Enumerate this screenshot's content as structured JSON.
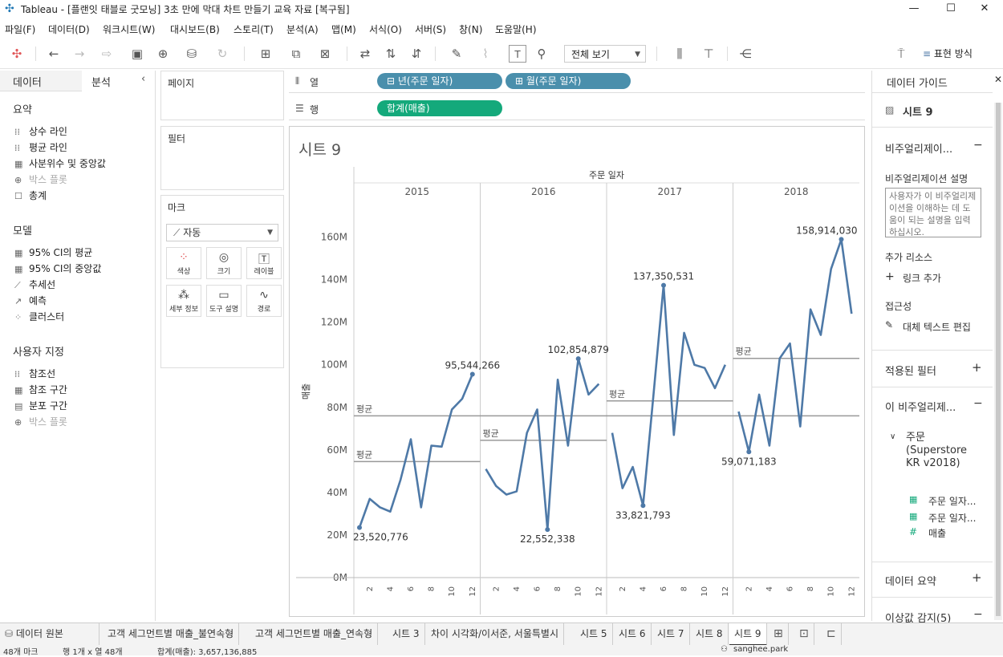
{
  "window": {
    "title": "Tableau - [플랜잇 태블로 굿모닝] 3초 만에 막대 차트 만들기 교육 자료 [복구됨]",
    "buttons": [
      "—",
      "☐",
      "✕"
    ]
  },
  "menu": [
    "파일(F)",
    "데이터(D)",
    "워크시트(W)",
    "대시보드(B)",
    "스토리(T)",
    "분석(A)",
    "맵(M)",
    "서식(O)",
    "서버(S)",
    "창(N)",
    "도움말(H)"
  ],
  "toolbar": {
    "fit_select": "전체 보기",
    "show_me": "표현 방식"
  },
  "left_panel": {
    "tabs": [
      "데이터",
      "분석"
    ],
    "summary_title": "요약",
    "summary_items": [
      {
        "label": "상수 라인",
        "enabled": true
      },
      {
        "label": "평균 라인",
        "enabled": true
      },
      {
        "label": "사분위수 및 중앙값",
        "enabled": true
      },
      {
        "label": "박스 플롯",
        "enabled": false
      },
      {
        "label": "총계",
        "enabled": true
      }
    ],
    "model_title": "모델",
    "model_items": [
      {
        "label": "95% CI의 평균",
        "enabled": true
      },
      {
        "label": "95% CI의 중앙값",
        "enabled": true
      },
      {
        "label": "추세선",
        "enabled": true
      },
      {
        "label": "예측",
        "enabled": true
      },
      {
        "label": "클러스터",
        "enabled": true
      }
    ],
    "custom_title": "사용자 지정",
    "custom_items": [
      {
        "label": "참조선",
        "enabled": true
      },
      {
        "label": "참조 구간",
        "enabled": true
      },
      {
        "label": "분포 구간",
        "enabled": true
      },
      {
        "label": "박스 플롯",
        "enabled": false
      }
    ]
  },
  "cards": {
    "pages": "페이지",
    "filters": "필터",
    "marks": "마크",
    "mark_type": "자동",
    "mark_buttons": [
      "색상",
      "크기",
      "레이블",
      "세부 정보",
      "도구 설명",
      "경로"
    ]
  },
  "shelves": {
    "columns_label": "열",
    "rows_label": "행",
    "columns_pills": [
      "년(주문 일자)",
      "월(주문 일자)"
    ],
    "rows_pills": [
      "합계(매출)"
    ]
  },
  "view": {
    "sheet_title": "시트 9",
    "header_title": "주문 일자",
    "years": [
      "2015",
      "2016",
      "2017",
      "2018"
    ],
    "y_axis_label": "매출",
    "y_ticks": [
      "0M",
      "20M",
      "40M",
      "60M",
      "80M",
      "100M",
      "120M",
      "140M",
      "160M"
    ],
    "x_ticks": [
      "2",
      "4",
      "6",
      "8",
      "10",
      "12"
    ],
    "avg_label": "평균"
  },
  "chart_data": {
    "type": "line",
    "x_label": "주문 일자",
    "y_label": "매출",
    "ylim": [
      0,
      170000000
    ],
    "panes": [
      "2015",
      "2016",
      "2017",
      "2018"
    ],
    "series": [
      {
        "year": "2015",
        "values": [
          23520776,
          37000000,
          33000000,
          31000000,
          46000000,
          65000000,
          33000000,
          62000000,
          61500000,
          79000000,
          84000000,
          95544266
        ]
      },
      {
        "year": "2016",
        "values": [
          51000000,
          43000000,
          39000000,
          40500000,
          68000000,
          79000000,
          22552338,
          93000000,
          62000000,
          102854879,
          86000000,
          91000000
        ]
      },
      {
        "year": "2017",
        "values": [
          68000000,
          42000000,
          52000000,
          33821793,
          85000000,
          137350531,
          67000000,
          115000000,
          100000000,
          98500000,
          89000000,
          100000000
        ]
      },
      {
        "year": "2018",
        "values": [
          78000000,
          59071183,
          86000000,
          62000000,
          103000000,
          110000000,
          71000000,
          126000000,
          114000000,
          145000000,
          158914030,
          124000000
        ]
      }
    ],
    "pane_averages": [
      54500000,
      64500000,
      83000000,
      103000000
    ],
    "overall_average": 76000000,
    "data_labels": [
      {
        "year": "2015",
        "month": 1,
        "text": "23,520,776"
      },
      {
        "year": "2015",
        "month": 12,
        "text": "95,544,266"
      },
      {
        "year": "2016",
        "month": 7,
        "text": "22,552,338"
      },
      {
        "year": "2016",
        "month": 10,
        "text": "102,854,879"
      },
      {
        "year": "2017",
        "month": 4,
        "text": "33,821,793"
      },
      {
        "year": "2017",
        "month": 6,
        "text": "137,350,531"
      },
      {
        "year": "2018",
        "month": 2,
        "text": "59,071,183"
      },
      {
        "year": "2018",
        "month": 11,
        "text": "158,914,030"
      }
    ],
    "line_color": "#4e79a7"
  },
  "right_panel": {
    "title": "데이터 가이드",
    "sheet": "시트 9",
    "viz_section": "비주얼리제이...",
    "viz_desc_label": "비주얼리제이션 설명",
    "viz_desc_text": "사용자가 이 비주얼리제이션을 이해하는 데 도움이 되는 설명을 입력하십시오.",
    "resources": "추가 리소스",
    "add_link": "링크 추가",
    "accessibility": "접근성",
    "alt_text": "대체 텍스트 편집",
    "applied_filters": "적용된 필터",
    "this_viz": "이 비주얼리제...",
    "datasource": "주문 (Superstore KR v2018)",
    "fields": [
      "주문 일자...",
      "주문 일자...",
      "매출"
    ],
    "data_summary": "데이터 요약",
    "outliers": "이상값 감지(5)"
  },
  "sheet_tabs": [
    "데이터 원본",
    "고객 세그먼트별 매출_불연속형",
    "고객 세그먼트별 매출_연속형",
    "시트 3",
    "차이 시각화/이서준, 서울특별시",
    "시트 5",
    "시트 6",
    "시트 7",
    "시트 8",
    "시트 9"
  ],
  "status": {
    "marks": "48개 마크",
    "rows_cols": "행 1개 x 열 48개",
    "sum": "합계(매출): 3,657,136,885",
    "user": "sanghee.park"
  }
}
